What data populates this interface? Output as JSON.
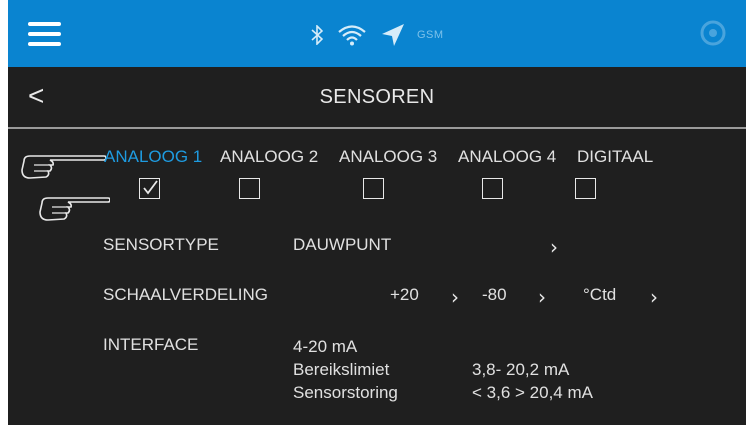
{
  "statusbar": {
    "gsm_label": "GSM",
    "icons": [
      "menu-icon",
      "bluetooth-icon",
      "wifi-icon",
      "location-arrow-icon",
      "settings-icon"
    ]
  },
  "header": {
    "back_glyph": "<",
    "title": "SENSOREN"
  },
  "tabs": [
    {
      "label": "ANALOOG 1",
      "active": true,
      "checked": true
    },
    {
      "label": "ANALOOG 2",
      "active": false,
      "checked": false
    },
    {
      "label": "ANALOOG 3",
      "active": false,
      "checked": false
    },
    {
      "label": "ANALOOG 4",
      "active": false,
      "checked": false
    },
    {
      "label": "DIGITAAL",
      "active": false,
      "checked": false
    }
  ],
  "sensortype": {
    "label": "SENSORTYPE",
    "value": "DAUWPUNT"
  },
  "schaalverdeling": {
    "label": "SCHAALVERDELING",
    "max": "+20",
    "min": "-80",
    "unit": "°Ctd"
  },
  "interface": {
    "label": "INTERFACE",
    "value": "4-20 mA",
    "range_label": "Bereikslimiet",
    "range_value": "3,8- 20,2 mA",
    "fault_label": "Sensorstoring",
    "fault_value": "< 3,6 > 20,4 mA"
  },
  "colors": {
    "topbar": "#0a84d0",
    "background": "#1f1f1f",
    "active_tab": "#1e9be0",
    "text": "#e0e0e0"
  }
}
